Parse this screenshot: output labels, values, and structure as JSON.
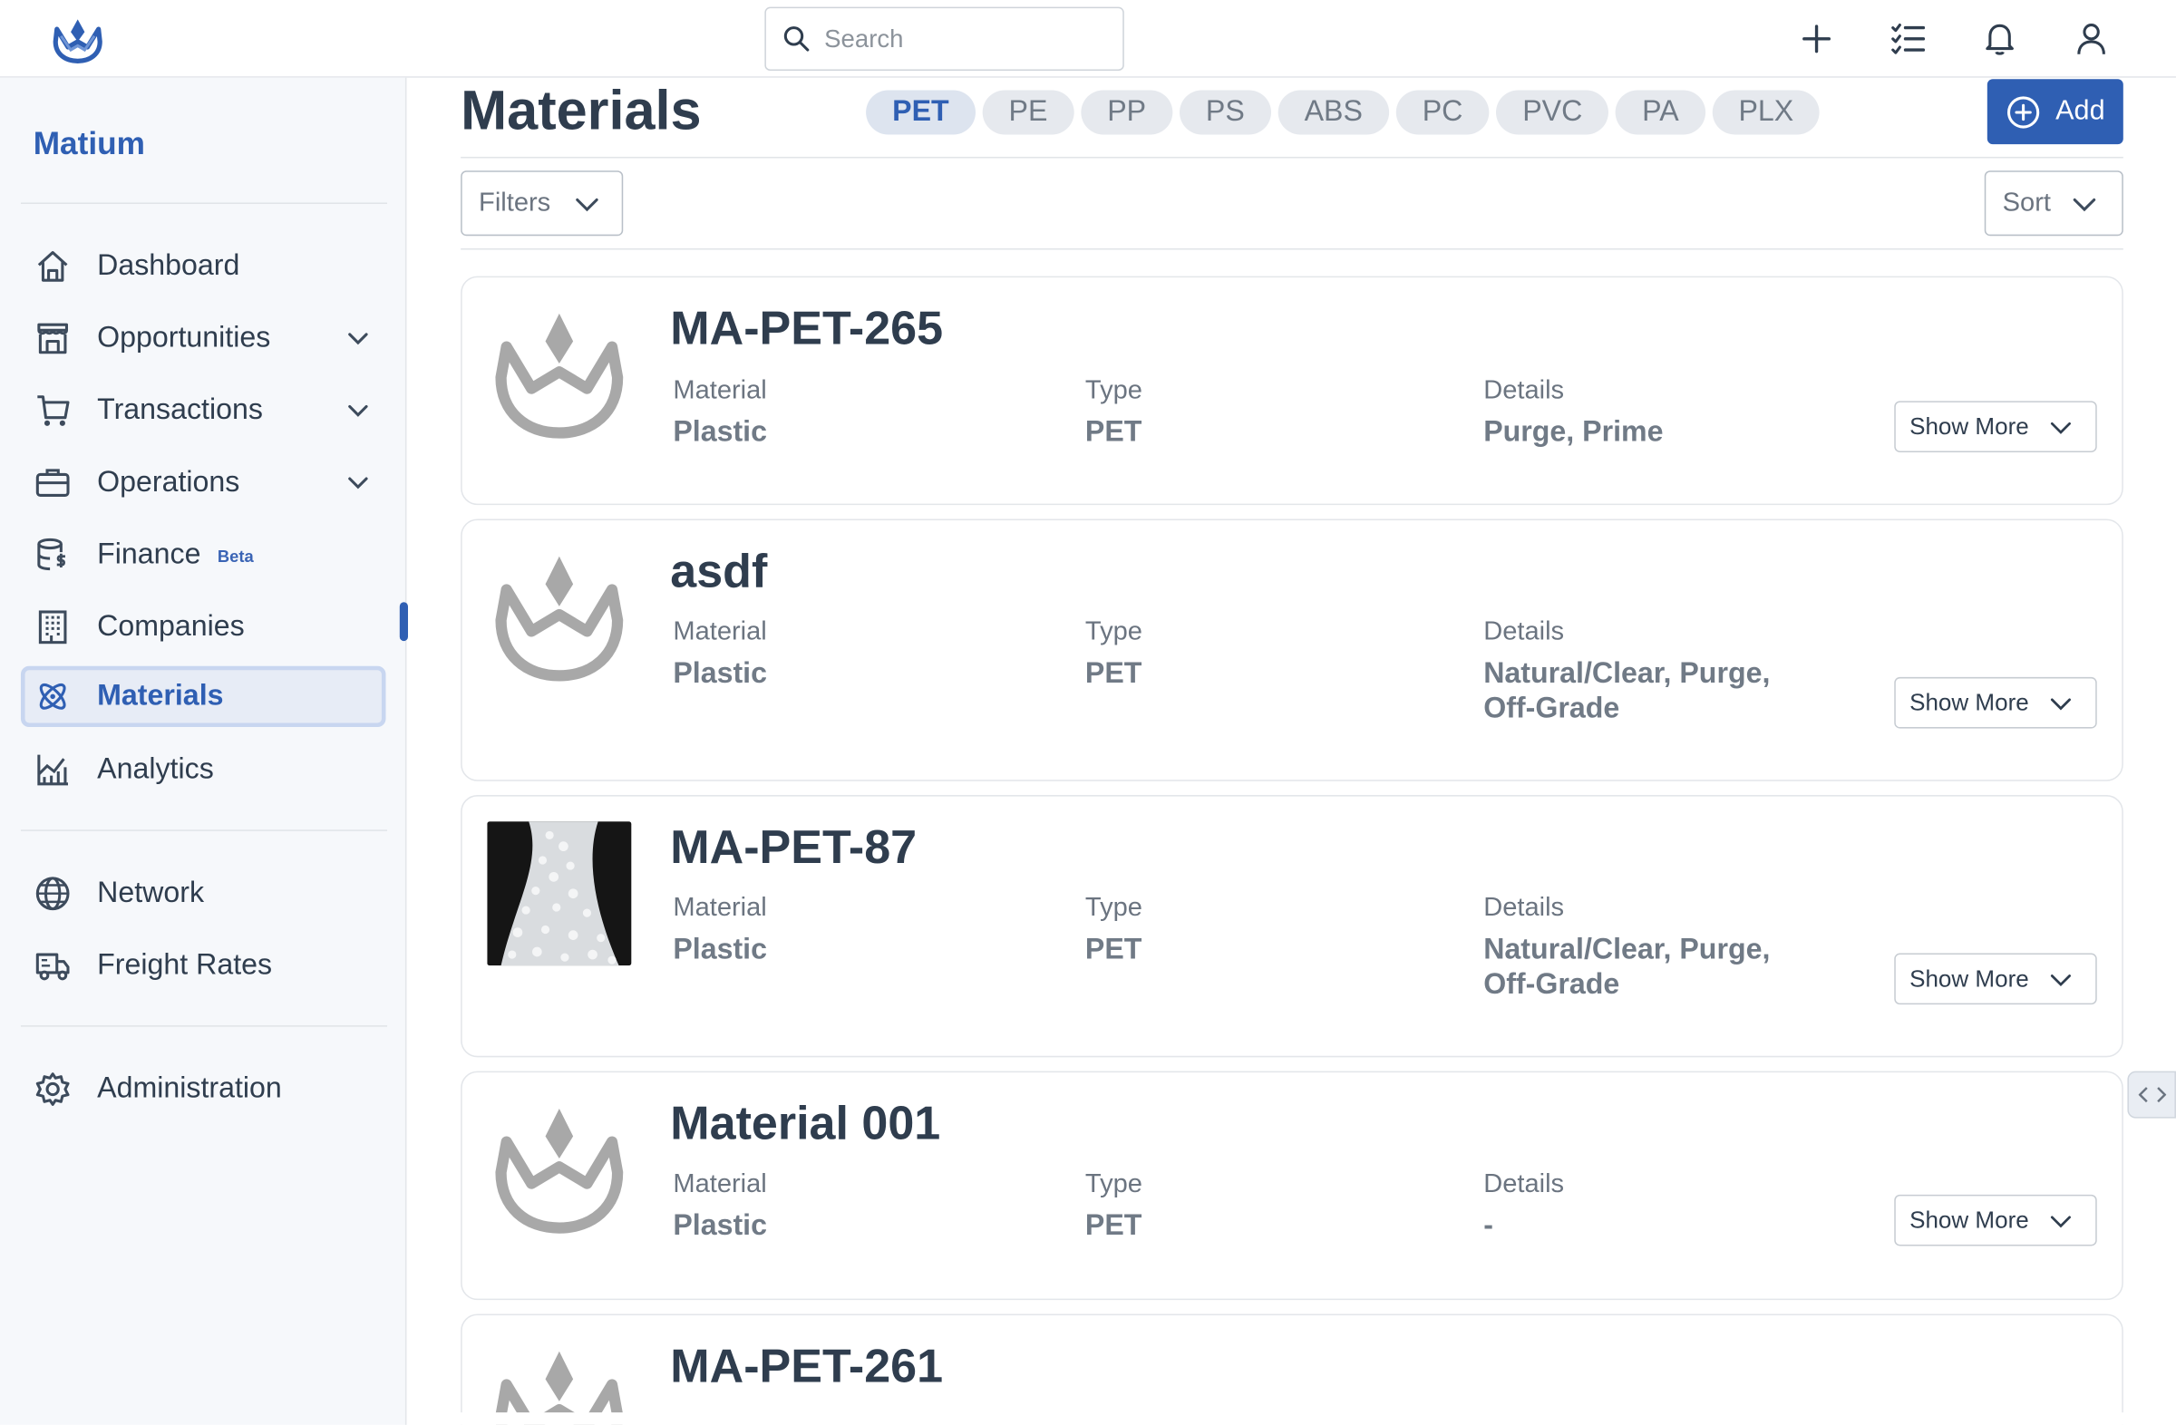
{
  "search": {
    "placeholder": "Search"
  },
  "sidebar": {
    "brand": "Matium",
    "items": [
      {
        "label": "Dashboard"
      },
      {
        "label": "Opportunities"
      },
      {
        "label": "Transactions"
      },
      {
        "label": "Operations"
      },
      {
        "label": "Finance",
        "badge": "Beta"
      },
      {
        "label": "Companies"
      },
      {
        "label": "Materials"
      },
      {
        "label": "Analytics"
      },
      {
        "label": "Network"
      },
      {
        "label": "Freight Rates"
      },
      {
        "label": "Administration"
      }
    ]
  },
  "main": {
    "title": "Materials",
    "chips": [
      "PET",
      "PE",
      "PP",
      "PS",
      "ABS",
      "PC",
      "PVC",
      "PA",
      "PLX"
    ],
    "add_label": "Add",
    "filters_label": "Filters",
    "sort_label": "Sort",
    "cards": [
      {
        "name": "MA-PET-265",
        "material_label": "Material",
        "material": "Plastic",
        "type_label": "Type",
        "type": "PET",
        "details_label": "Details",
        "details": "Purge, Prime",
        "show_more": "Show More"
      },
      {
        "name": "asdf",
        "material_label": "Material",
        "material": "Plastic",
        "type_label": "Type",
        "type": "PET",
        "details_label": "Details",
        "details": "Natural/Clear, Purge, Off-Grade",
        "show_more": "Show More"
      },
      {
        "name": "MA-PET-87",
        "material_label": "Material",
        "material": "Plastic",
        "type_label": "Type",
        "type": "PET",
        "details_label": "Details",
        "details": "Natural/Clear, Purge, Off-Grade",
        "show_more": "Show More"
      },
      {
        "name": "Material 001",
        "material_label": "Material",
        "material": "Plastic",
        "type_label": "Type",
        "type": "PET",
        "details_label": "Details",
        "details": "-",
        "show_more": "Show More"
      },
      {
        "name": "MA-PET-261"
      }
    ]
  },
  "colors": {
    "accent": "#2f5fb3",
    "sidebar_bg": "#f6f8fb",
    "placeholder_logo": "#a8a8a8"
  },
  "icons": [
    "matium-logo-icon",
    "search-icon",
    "plus-icon",
    "checklist-icon",
    "bell-icon",
    "user-icon",
    "home-icon",
    "store-icon",
    "cart-icon",
    "briefcase-icon",
    "database-dollar-icon",
    "building-icon",
    "atom-icon",
    "chart-icon",
    "globe-icon",
    "truck-icon",
    "gear-icon",
    "chevron-down-icon",
    "plus-circle-icon",
    "code-icon"
  ]
}
